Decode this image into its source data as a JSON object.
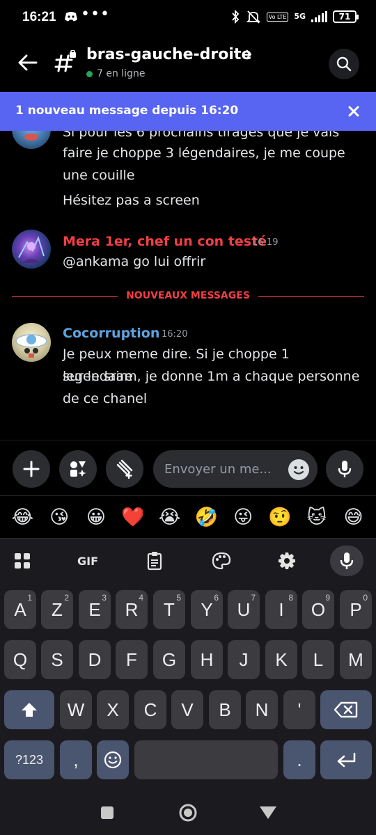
{
  "status_bar": {
    "time": "16:21",
    "dots": "•••",
    "volte": "Vo LTE",
    "network": "5G",
    "battery": "71"
  },
  "header": {
    "channel_name": "bras-gauche-droite",
    "online_text": "7 en ligne"
  },
  "banner": {
    "text": "1 nouveau message depuis 16:20"
  },
  "messages": {
    "top_lines": [
      "Si pour les 6 prochains tirages que je vais",
      "faire je choppe 3 légendaires, je me coupe",
      "une couille"
    ],
    "top_second": "Hésitez pas a screen",
    "msg2": {
      "author": "Mera 1er, chef un con testé",
      "time": "16:19",
      "text": "@ankama go lui offrir",
      "author_color": "#f23f43"
    },
    "divider_label": "NOUVEAUX MESSAGES",
    "msg3": {
      "author": "Cocorruption",
      "time": "16:20",
      "lines": [
        "Je peux meme dire. Si je choppe 1 legendaire",
        "sur le sram, je donne 1m a chaque personne",
        "de ce chanel"
      ],
      "author_color": "#5ea3e0"
    }
  },
  "composer": {
    "placeholder": "Envoyer un me..."
  },
  "emoji_suggestions": [
    "😂",
    "😘",
    "😀",
    "❤️",
    "😭",
    "🤣",
    "😜",
    "🤨",
    "🐱",
    "😅"
  ],
  "keyboard": {
    "gif_label": "GIF",
    "row1": [
      {
        "k": "A",
        "n": "1"
      },
      {
        "k": "Z",
        "n": "2"
      },
      {
        "k": "E",
        "n": "3"
      },
      {
        "k": "R",
        "n": "4"
      },
      {
        "k": "T",
        "n": "5"
      },
      {
        "k": "Y",
        "n": "6"
      },
      {
        "k": "U",
        "n": "7"
      },
      {
        "k": "I",
        "n": "8"
      },
      {
        "k": "O",
        "n": "9"
      },
      {
        "k": "P",
        "n": "0"
      }
    ],
    "row2": [
      "Q",
      "S",
      "D",
      "F",
      "G",
      "H",
      "J",
      "K",
      "L",
      "M"
    ],
    "row3": [
      "W",
      "X",
      "C",
      "V",
      "B",
      "N",
      "'"
    ],
    "symbols_label": "?123",
    "comma": ",",
    "period": "."
  },
  "colors": {
    "accent": "#5865f2",
    "background": "#000000",
    "online": "#23a55a"
  }
}
